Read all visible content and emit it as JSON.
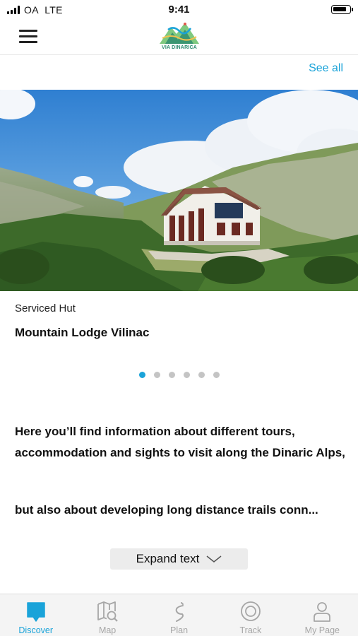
{
  "status_bar": {
    "carrier": "OA",
    "network": "LTE",
    "time": "9:41"
  },
  "header": {
    "logo_text": "VIA DINARICA",
    "menu_icon": "hamburger-menu-icon"
  },
  "featured": {
    "see_all_label": "See all",
    "category": "Serviced Hut",
    "title": "Mountain Lodge Vilinac",
    "pagination_total": 6,
    "pagination_active": 1
  },
  "intro": {
    "paragraph_1": "Here you’ll find information about different tours, accommodation and sights to visit along the Dinaric Alps,",
    "paragraph_2": "but also about developing long distance trails conn..."
  },
  "expand": {
    "label": "Expand text",
    "icon": "chevron-down-icon"
  },
  "tab_bar": {
    "tabs": [
      {
        "label": "Discover",
        "icon": "discover-icon",
        "active": true
      },
      {
        "label": "Map",
        "icon": "map-icon",
        "active": false
      },
      {
        "label": "Plan",
        "icon": "plan-icon",
        "active": false
      },
      {
        "label": "Track",
        "icon": "track-icon",
        "active": false
      },
      {
        "label": "My Page",
        "icon": "user-icon",
        "active": false
      }
    ]
  },
  "colors": {
    "accent": "#1aa3d9",
    "inactive": "#a6a6a6",
    "tab_background": "#f4f4f4"
  }
}
